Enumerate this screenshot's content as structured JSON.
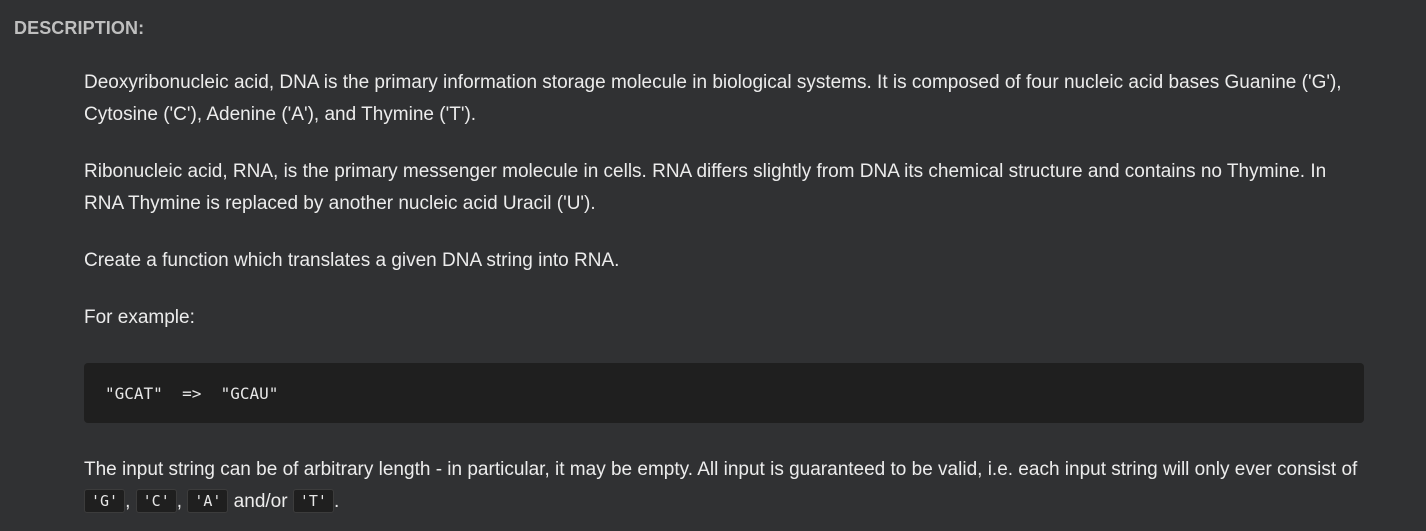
{
  "section": {
    "label": "DESCRIPTION:"
  },
  "description": {
    "p1": "Deoxyribonucleic acid, DNA is the primary information storage molecule in biological systems. It is composed of four nucleic acid bases Guanine ('G'), Cytosine ('C'), Adenine ('A'), and Thymine ('T').",
    "p2": "Ribonucleic acid, RNA, is the primary messenger molecule in cells. RNA differs slightly from DNA its chemical structure and contains no Thymine. In RNA Thymine is replaced by another nucleic acid Uracil ('U').",
    "p3": "Create a function which translates a given DNA string into RNA.",
    "p4": "For example:",
    "code_example": "\"GCAT\"  =>  \"GCAU\"",
    "p5_text": "The input string can be of arbitrary length - in particular, it may be empty. All input is guaranteed to be valid, i.e. each input string will only ever consist of ",
    "p5_code_g": "'G'",
    "p5_sep1": ", ",
    "p5_code_c": "'C'",
    "p5_sep2": ", ",
    "p5_code_a": "'A'",
    "p5_sep3": " and/or ",
    "p5_code_t": "'T'",
    "p5_end": "."
  }
}
